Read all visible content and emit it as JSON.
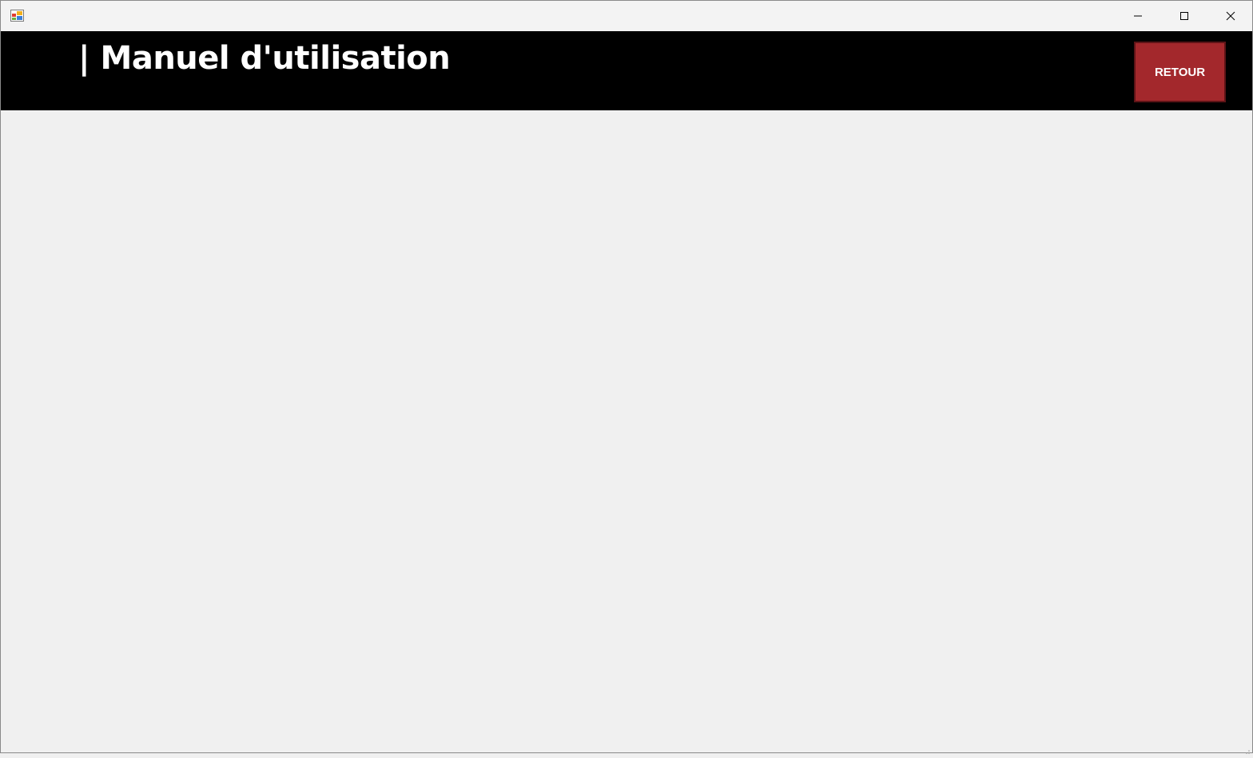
{
  "window": {
    "icon": "app-form-icon",
    "controls": {
      "minimize_icon": "minimize-icon",
      "maximize_icon": "maximize-icon",
      "close_icon": "close-icon"
    }
  },
  "header": {
    "title": "| Manuel d'utilisation",
    "back_label": "RETOUR",
    "background_color": "#000000",
    "back_button_color": "#a3282c"
  }
}
